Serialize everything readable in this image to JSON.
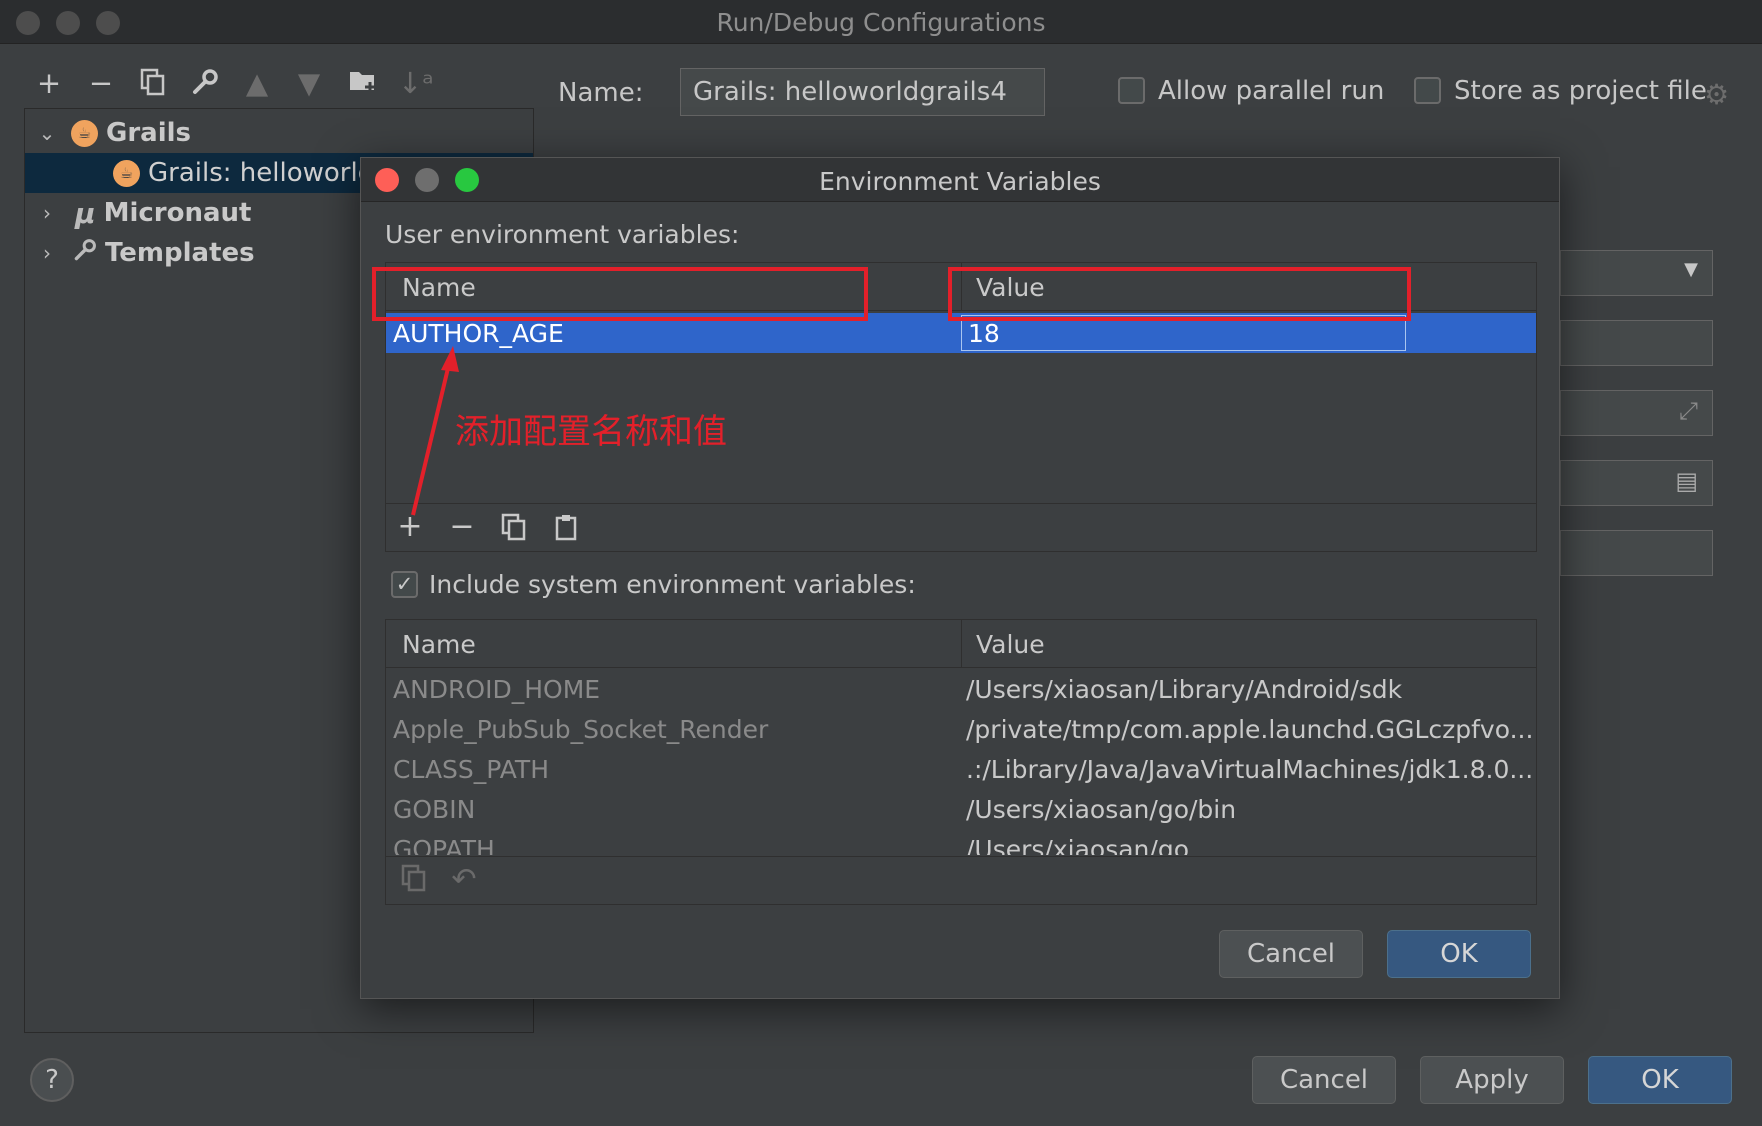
{
  "window": {
    "title": "Run/Debug Configurations"
  },
  "toolbar": {
    "icons": [
      "add-icon",
      "remove-icon",
      "copy-icon",
      "wrench-icon",
      "move-up-icon",
      "move-down-icon",
      "folder-add-icon",
      "sort-icon"
    ]
  },
  "tree": {
    "items": [
      {
        "label": "Grails",
        "expanded": true
      },
      {
        "label": "Grails: helloworld",
        "selected": true
      },
      {
        "label": "Micronaut",
        "expanded": false
      },
      {
        "label": "Templates",
        "expanded": false
      }
    ]
  },
  "config": {
    "name_label": "Name:",
    "name_value": "Grails: helloworldgrails4",
    "allow_parallel_label": "Allow parallel run",
    "store_as_project_label": "Store as project file"
  },
  "dialog": {
    "title": "Environment Variables",
    "user_vars_label": "User environment variables:",
    "col_name": "Name",
    "col_value": "Value",
    "user_vars": [
      {
        "name": "AUTHOR_AGE",
        "value": "18"
      }
    ],
    "annotation": "添加配置名称和值",
    "include_system_label": "Include system environment variables:",
    "include_system_checked": true,
    "sys_col_name": "Name",
    "sys_col_value": "Value",
    "system_vars": [
      {
        "name": "ANDROID_HOME",
        "value": "/Users/xiaosan/Library/Android/sdk"
      },
      {
        "name": "Apple_PubSub_Socket_Render",
        "value": "/private/tmp/com.apple.launchd.GGLczpfvo..."
      },
      {
        "name": "CLASS_PATH",
        "value": ".:/Library/Java/JavaVirtualMachines/jdk1.8.0..."
      },
      {
        "name": "GOBIN",
        "value": "/Users/xiaosan/go/bin"
      },
      {
        "name": "GOPATH",
        "value": "/Users/xiaosan/go"
      }
    ],
    "cancel_label": "Cancel",
    "ok_label": "OK"
  },
  "footer": {
    "help_label": "?",
    "cancel_label": "Cancel",
    "apply_label": "Apply",
    "ok_label": "OK"
  },
  "colors": {
    "selection": "#2f65ca",
    "annotation_red": "#e3202a",
    "primary_button": "#365880"
  }
}
